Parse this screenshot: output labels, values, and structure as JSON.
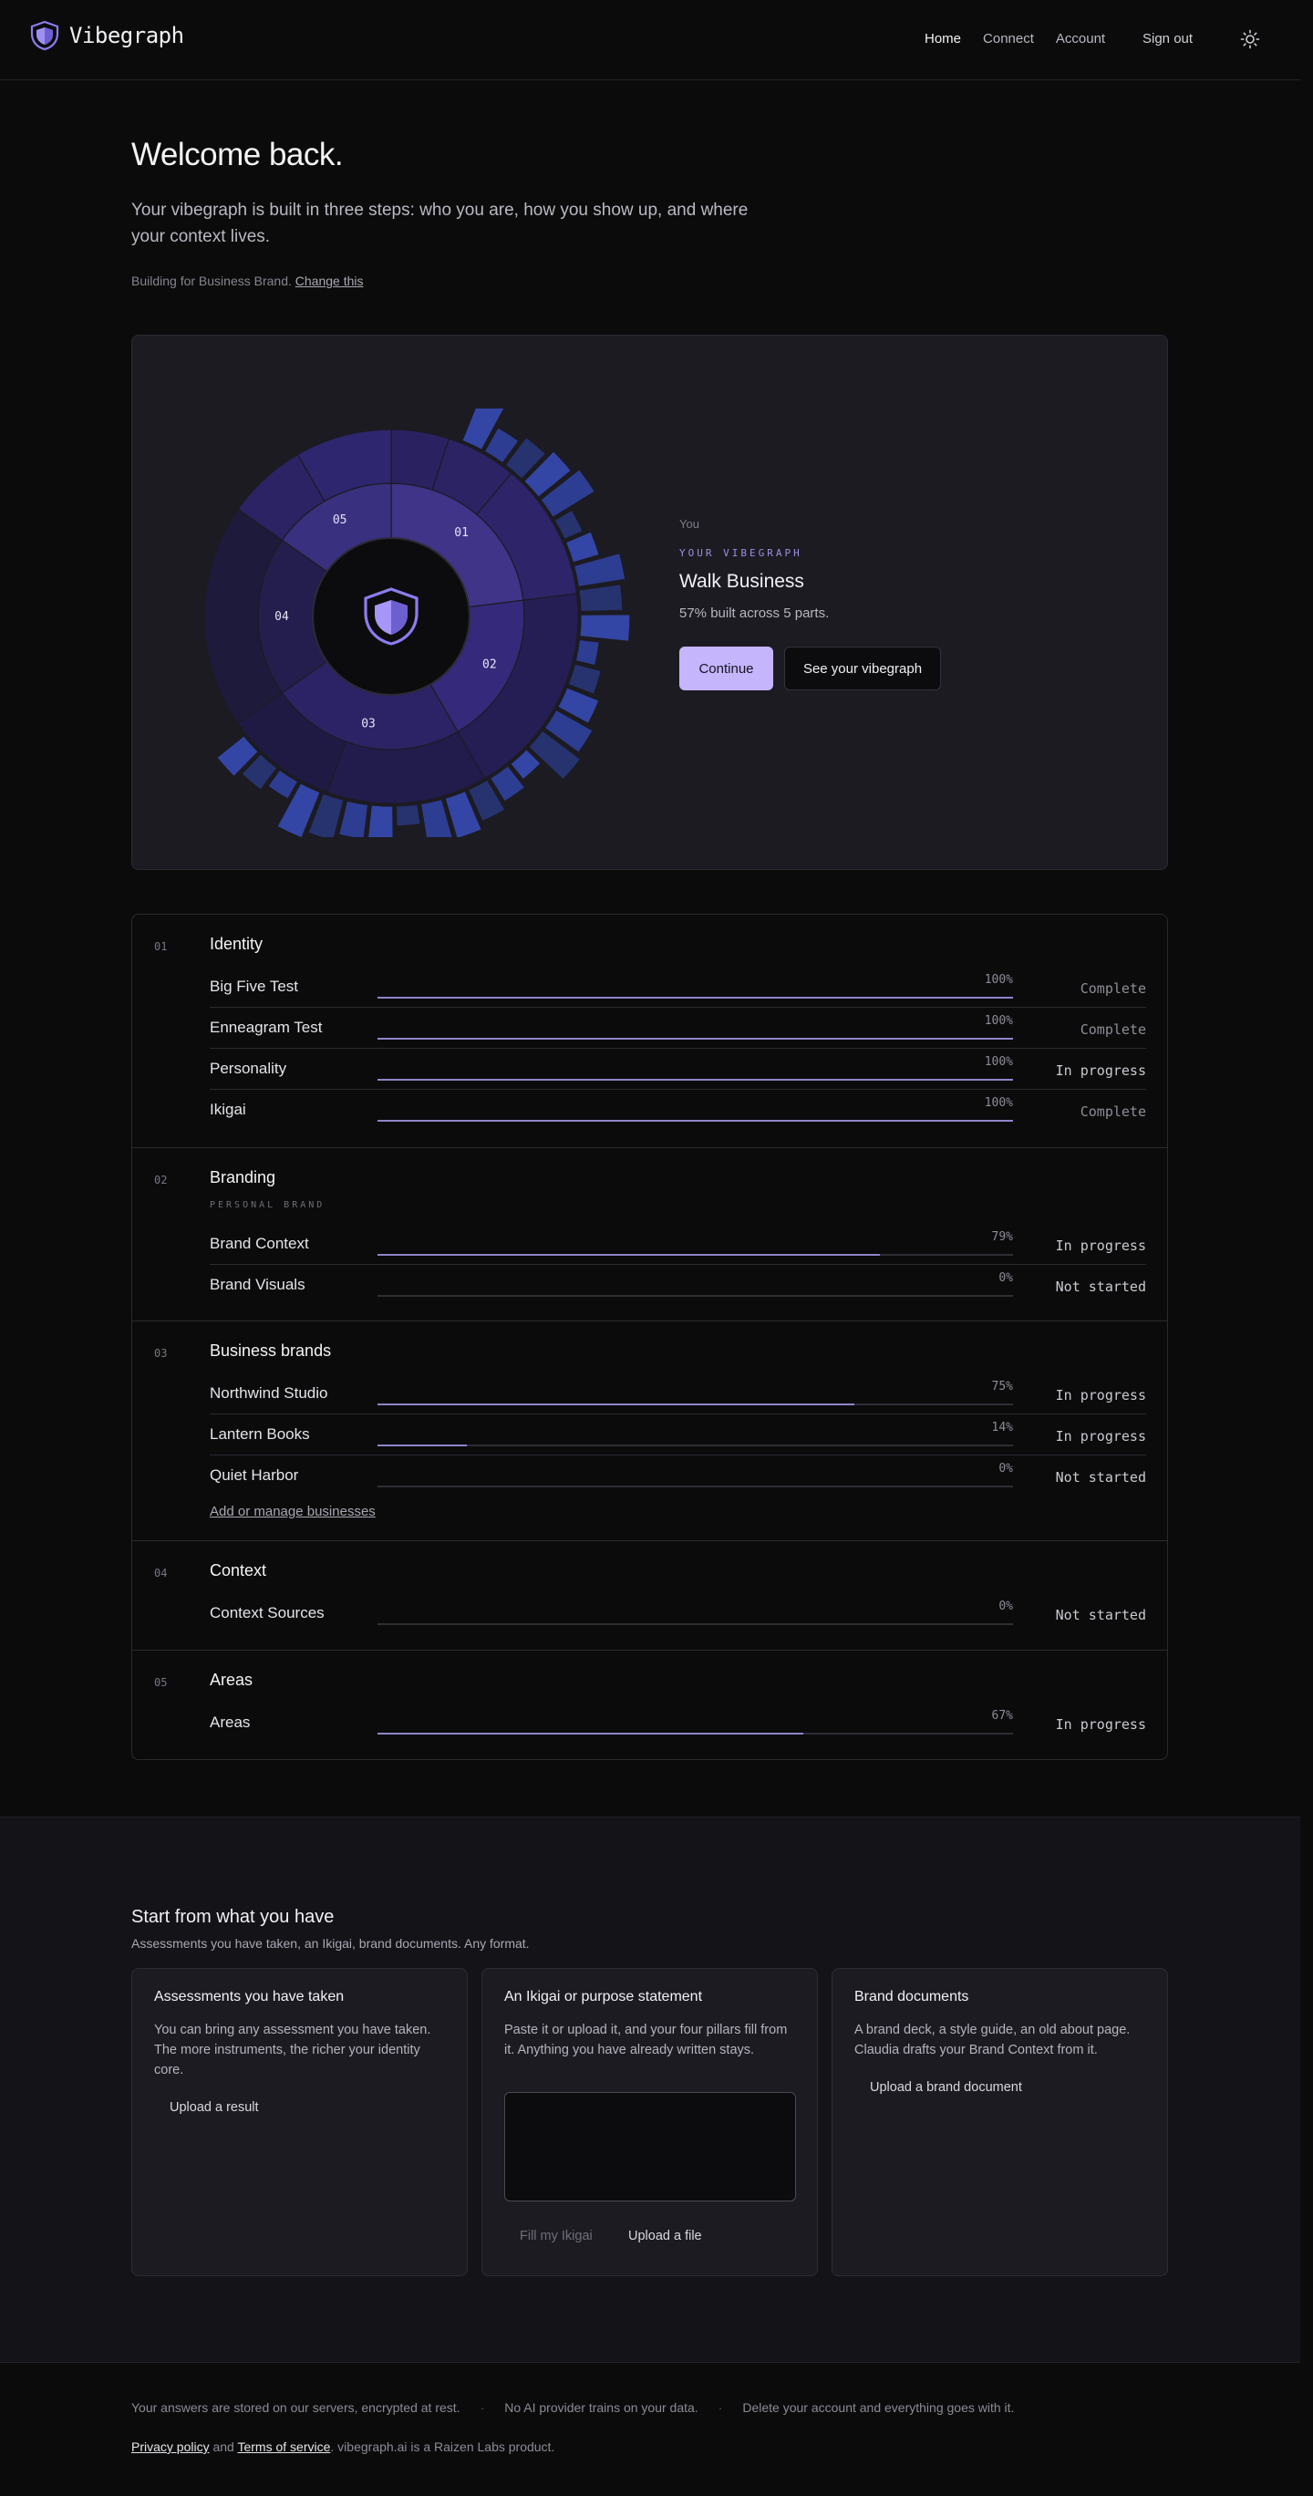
{
  "header": {
    "brand": "Vibegraph",
    "nav": [
      "Home",
      "Connect",
      "Account"
    ],
    "signout": "Sign out"
  },
  "hero": {
    "title": "Welcome back.",
    "subtitle": "Your vibegraph is built in three steps: who you are, how you show up, and where your context lives.",
    "building_prefix": "Building for Business Brand.",
    "change_link": "Change this"
  },
  "vibegraph": {
    "you": "You",
    "eyebrow": "YOUR VIBEGRAPH",
    "name": "Walk Business",
    "progress": "57% built across 5 parts.",
    "continue": "Continue",
    "see": "See your vibegraph",
    "segment_labels": [
      "01",
      "02",
      "03",
      "04",
      "05"
    ]
  },
  "sections": [
    {
      "num": "01",
      "title": "Identity",
      "eyebrow": "",
      "rows": [
        {
          "label": "Big Five Test",
          "pct": "100%",
          "fill": 1.0,
          "status": "Complete"
        },
        {
          "label": "Enneagram Test",
          "pct": "100%",
          "fill": 1.0,
          "status": "Complete"
        },
        {
          "label": "Personality",
          "pct": "100%",
          "fill": 1.0,
          "status": "In progress"
        },
        {
          "label": "Ikigai",
          "pct": "100%",
          "fill": 1.0,
          "status": "Complete"
        }
      ]
    },
    {
      "num": "02",
      "title": "Branding",
      "eyebrow": "PERSONAL BRAND",
      "rows": [
        {
          "label": "Brand Context",
          "pct": "79%",
          "fill": 0.79,
          "status": "In progress"
        },
        {
          "label": "Brand Visuals",
          "pct": "0%",
          "fill": 0,
          "status": "Not started"
        }
      ]
    },
    {
      "num": "03",
      "title": "Business brands",
      "eyebrow": "",
      "rows": [
        {
          "label": "Northwind Studio",
          "pct": "75%",
          "fill": 0.75,
          "status": "In progress"
        },
        {
          "label": "Lantern Books",
          "pct": "14%",
          "fill": 0.14,
          "status": "In progress"
        },
        {
          "label": "Quiet Harbor",
          "pct": "0%",
          "fill": 0,
          "status": "Not started"
        }
      ],
      "link": "Add or manage businesses"
    },
    {
      "num": "04",
      "title": "Context",
      "eyebrow": "",
      "rows": [
        {
          "label": "Context Sources",
          "pct": "0%",
          "fill": 0,
          "status": "Not started"
        }
      ]
    },
    {
      "num": "05",
      "title": "Areas",
      "eyebrow": "",
      "rows": [
        {
          "label": "Areas",
          "pct": "67%",
          "fill": 0.67,
          "status": "In progress"
        }
      ]
    }
  ],
  "start": {
    "title": "Start from what you have",
    "subtitle": "Assessments you have taken, an Ikigai, brand documents. Any format.",
    "cards": [
      {
        "title": "Assessments you have taken",
        "body": "You can bring any assessment you have taken. The more instruments, the richer your identity core.",
        "button": "Upload a result"
      },
      {
        "title": "An Ikigai or purpose statement",
        "body": "Paste it or upload it, and your four pillars fill from it. Anything you have already written stays.",
        "button_muted": "Fill my Ikigai",
        "button": "Upload a file"
      },
      {
        "title": "Brand documents",
        "body": "A brand deck, a style guide, an old about page. Claudia drafts your Brand Context from it.",
        "button": "Upload a brand document"
      }
    ]
  },
  "footer": {
    "notes": [
      "Your answers are stored on our servers, encrypted at rest.",
      "No AI provider trains on your data.",
      "Delete your account and everything goes with it."
    ],
    "privacy": "Privacy policy",
    "and": "and",
    "terms": "Terms of service",
    "tail": ". vibegraph.ai is a Raizen Labs product."
  }
}
